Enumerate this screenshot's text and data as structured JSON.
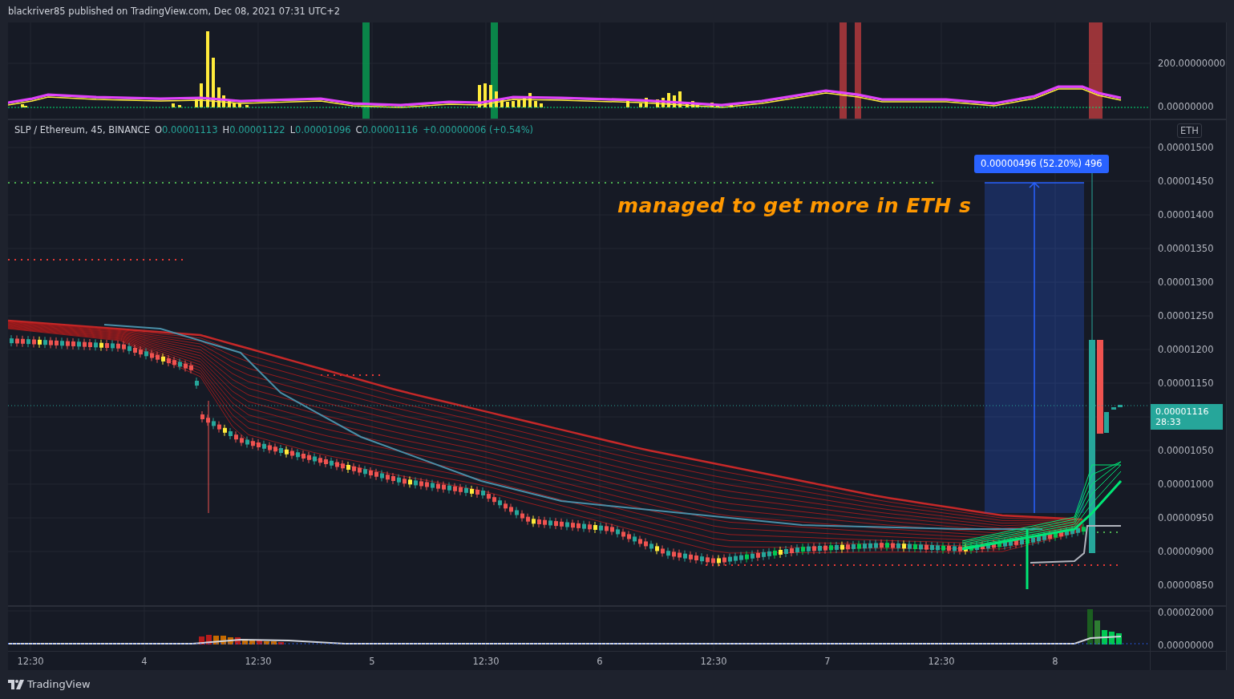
{
  "header": {
    "text": "blackriver85 published on TradingView.com, Dec 08, 2021 07:31 UTC+2"
  },
  "indicator_pane": {
    "axis_labels": [
      "200.00000000",
      "0.00000000"
    ]
  },
  "main_pane": {
    "legend": {
      "symbol": "SLP / Ethereum, 45, BINANCE",
      "fields": [
        {
          "key": "O",
          "value": "0.00001113"
        },
        {
          "key": "H",
          "value": "0.00001122"
        },
        {
          "key": "L",
          "value": "0.00001096"
        },
        {
          "key": "C",
          "value": "0.00001116"
        }
      ],
      "change": "+0.00000006 (+0.54%)"
    },
    "annotation": "managed to get more in ETH s",
    "measure_label": "0.00000496 (52.20%) 496",
    "currency_badge": "ETH",
    "price_axis": [
      {
        "kind": "tick",
        "label": "0.00001500"
      },
      {
        "kind": "tick",
        "label": "0.00001450"
      },
      {
        "kind": "tick",
        "label": "0.00001400"
      },
      {
        "kind": "tick",
        "label": "0.00001350"
      },
      {
        "kind": "tick",
        "label": "0.00001300"
      },
      {
        "kind": "tick",
        "label": "0.00001250"
      },
      {
        "kind": "tick",
        "label": "0.00001200"
      },
      {
        "kind": "tick",
        "label": "0.00001150"
      },
      {
        "kind": "current",
        "price": "0.00001116",
        "countdown": "28:33"
      },
      {
        "kind": "tick",
        "label": "0.00001050"
      },
      {
        "kind": "tick",
        "label": "0.00001000"
      },
      {
        "kind": "tick",
        "label": "0.00000950"
      },
      {
        "kind": "tick",
        "label": "0.00000900"
      },
      {
        "kind": "tick",
        "label": "0.00000850"
      }
    ]
  },
  "volume_pane": {
    "axis_labels": [
      "0.00002000",
      "0.00000000"
    ]
  },
  "time_axis": [
    "12:30",
    "4",
    "12:30",
    "5",
    "12:30",
    "6",
    "12:30",
    "7",
    "12:30",
    "8"
  ],
  "footer": {
    "brand": "TradingView"
  }
}
